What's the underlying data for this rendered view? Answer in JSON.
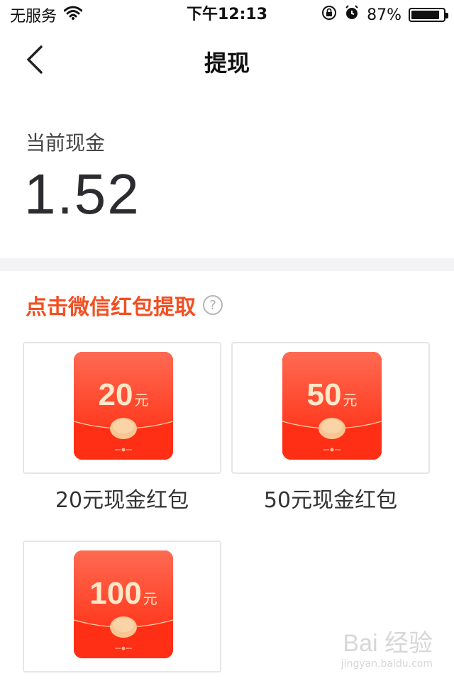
{
  "status_bar": {
    "carrier": "无服务",
    "time": "下午12:13",
    "battery_percent": "87%",
    "battery_level": 0.87,
    "icons": [
      "wifi-icon",
      "rotation-lock-icon",
      "alarm-icon",
      "battery-icon"
    ]
  },
  "nav": {
    "title": "提现",
    "back_icon": "chevron-left-icon"
  },
  "balance": {
    "label": "当前现金",
    "value": "1.52"
  },
  "section": {
    "title": "点击微信红包提取",
    "help_icon": "question-circle-icon"
  },
  "colors": {
    "accent": "#f24f22",
    "packet_red": "#ff2f16",
    "packet_top": "#ff6a52",
    "coin": "#f6c592",
    "text_dark": "#2b2b30"
  },
  "packets": [
    {
      "amount": "20",
      "unit": "元",
      "label": "20元现金红包"
    },
    {
      "amount": "50",
      "unit": "元",
      "label": "50元现金红包"
    },
    {
      "amount": "100",
      "unit": "元",
      "label": ""
    }
  ],
  "watermark": {
    "main": "Bai 经验",
    "sub": "jingyan.baidu.com"
  }
}
